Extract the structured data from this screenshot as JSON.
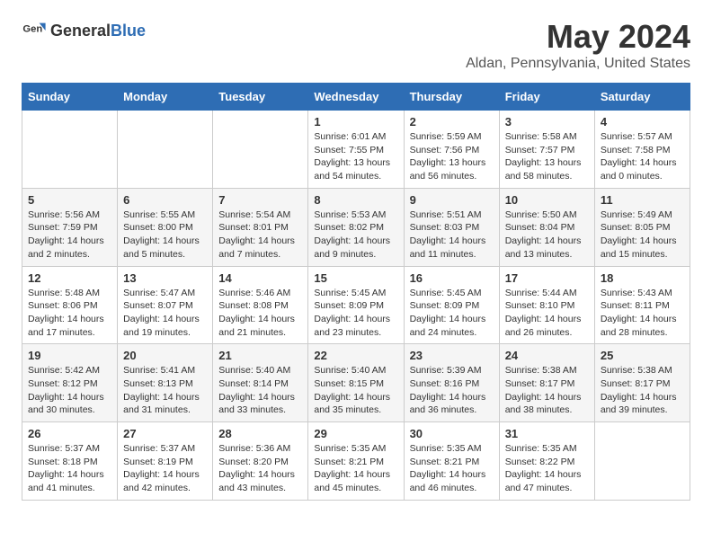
{
  "header": {
    "logo_general": "General",
    "logo_blue": "Blue",
    "title": "May 2024",
    "subtitle": "Aldan, Pennsylvania, United States"
  },
  "calendar": {
    "days_of_week": [
      "Sunday",
      "Monday",
      "Tuesday",
      "Wednesday",
      "Thursday",
      "Friday",
      "Saturday"
    ],
    "weeks": [
      [
        {
          "day": "",
          "info": ""
        },
        {
          "day": "",
          "info": ""
        },
        {
          "day": "",
          "info": ""
        },
        {
          "day": "1",
          "info": "Sunrise: 6:01 AM\nSunset: 7:55 PM\nDaylight: 13 hours\nand 54 minutes."
        },
        {
          "day": "2",
          "info": "Sunrise: 5:59 AM\nSunset: 7:56 PM\nDaylight: 13 hours\nand 56 minutes."
        },
        {
          "day": "3",
          "info": "Sunrise: 5:58 AM\nSunset: 7:57 PM\nDaylight: 13 hours\nand 58 minutes."
        },
        {
          "day": "4",
          "info": "Sunrise: 5:57 AM\nSunset: 7:58 PM\nDaylight: 14 hours\nand 0 minutes."
        }
      ],
      [
        {
          "day": "5",
          "info": "Sunrise: 5:56 AM\nSunset: 7:59 PM\nDaylight: 14 hours\nand 2 minutes."
        },
        {
          "day": "6",
          "info": "Sunrise: 5:55 AM\nSunset: 8:00 PM\nDaylight: 14 hours\nand 5 minutes."
        },
        {
          "day": "7",
          "info": "Sunrise: 5:54 AM\nSunset: 8:01 PM\nDaylight: 14 hours\nand 7 minutes."
        },
        {
          "day": "8",
          "info": "Sunrise: 5:53 AM\nSunset: 8:02 PM\nDaylight: 14 hours\nand 9 minutes."
        },
        {
          "day": "9",
          "info": "Sunrise: 5:51 AM\nSunset: 8:03 PM\nDaylight: 14 hours\nand 11 minutes."
        },
        {
          "day": "10",
          "info": "Sunrise: 5:50 AM\nSunset: 8:04 PM\nDaylight: 14 hours\nand 13 minutes."
        },
        {
          "day": "11",
          "info": "Sunrise: 5:49 AM\nSunset: 8:05 PM\nDaylight: 14 hours\nand 15 minutes."
        }
      ],
      [
        {
          "day": "12",
          "info": "Sunrise: 5:48 AM\nSunset: 8:06 PM\nDaylight: 14 hours\nand 17 minutes."
        },
        {
          "day": "13",
          "info": "Sunrise: 5:47 AM\nSunset: 8:07 PM\nDaylight: 14 hours\nand 19 minutes."
        },
        {
          "day": "14",
          "info": "Sunrise: 5:46 AM\nSunset: 8:08 PM\nDaylight: 14 hours\nand 21 minutes."
        },
        {
          "day": "15",
          "info": "Sunrise: 5:45 AM\nSunset: 8:09 PM\nDaylight: 14 hours\nand 23 minutes."
        },
        {
          "day": "16",
          "info": "Sunrise: 5:45 AM\nSunset: 8:09 PM\nDaylight: 14 hours\nand 24 minutes."
        },
        {
          "day": "17",
          "info": "Sunrise: 5:44 AM\nSunset: 8:10 PM\nDaylight: 14 hours\nand 26 minutes."
        },
        {
          "day": "18",
          "info": "Sunrise: 5:43 AM\nSunset: 8:11 PM\nDaylight: 14 hours\nand 28 minutes."
        }
      ],
      [
        {
          "day": "19",
          "info": "Sunrise: 5:42 AM\nSunset: 8:12 PM\nDaylight: 14 hours\nand 30 minutes."
        },
        {
          "day": "20",
          "info": "Sunrise: 5:41 AM\nSunset: 8:13 PM\nDaylight: 14 hours\nand 31 minutes."
        },
        {
          "day": "21",
          "info": "Sunrise: 5:40 AM\nSunset: 8:14 PM\nDaylight: 14 hours\nand 33 minutes."
        },
        {
          "day": "22",
          "info": "Sunrise: 5:40 AM\nSunset: 8:15 PM\nDaylight: 14 hours\nand 35 minutes."
        },
        {
          "day": "23",
          "info": "Sunrise: 5:39 AM\nSunset: 8:16 PM\nDaylight: 14 hours\nand 36 minutes."
        },
        {
          "day": "24",
          "info": "Sunrise: 5:38 AM\nSunset: 8:17 PM\nDaylight: 14 hours\nand 38 minutes."
        },
        {
          "day": "25",
          "info": "Sunrise: 5:38 AM\nSunset: 8:17 PM\nDaylight: 14 hours\nand 39 minutes."
        }
      ],
      [
        {
          "day": "26",
          "info": "Sunrise: 5:37 AM\nSunset: 8:18 PM\nDaylight: 14 hours\nand 41 minutes."
        },
        {
          "day": "27",
          "info": "Sunrise: 5:37 AM\nSunset: 8:19 PM\nDaylight: 14 hours\nand 42 minutes."
        },
        {
          "day": "28",
          "info": "Sunrise: 5:36 AM\nSunset: 8:20 PM\nDaylight: 14 hours\nand 43 minutes."
        },
        {
          "day": "29",
          "info": "Sunrise: 5:35 AM\nSunset: 8:21 PM\nDaylight: 14 hours\nand 45 minutes."
        },
        {
          "day": "30",
          "info": "Sunrise: 5:35 AM\nSunset: 8:21 PM\nDaylight: 14 hours\nand 46 minutes."
        },
        {
          "day": "31",
          "info": "Sunrise: 5:35 AM\nSunset: 8:22 PM\nDaylight: 14 hours\nand 47 minutes."
        },
        {
          "day": "",
          "info": ""
        }
      ]
    ]
  }
}
